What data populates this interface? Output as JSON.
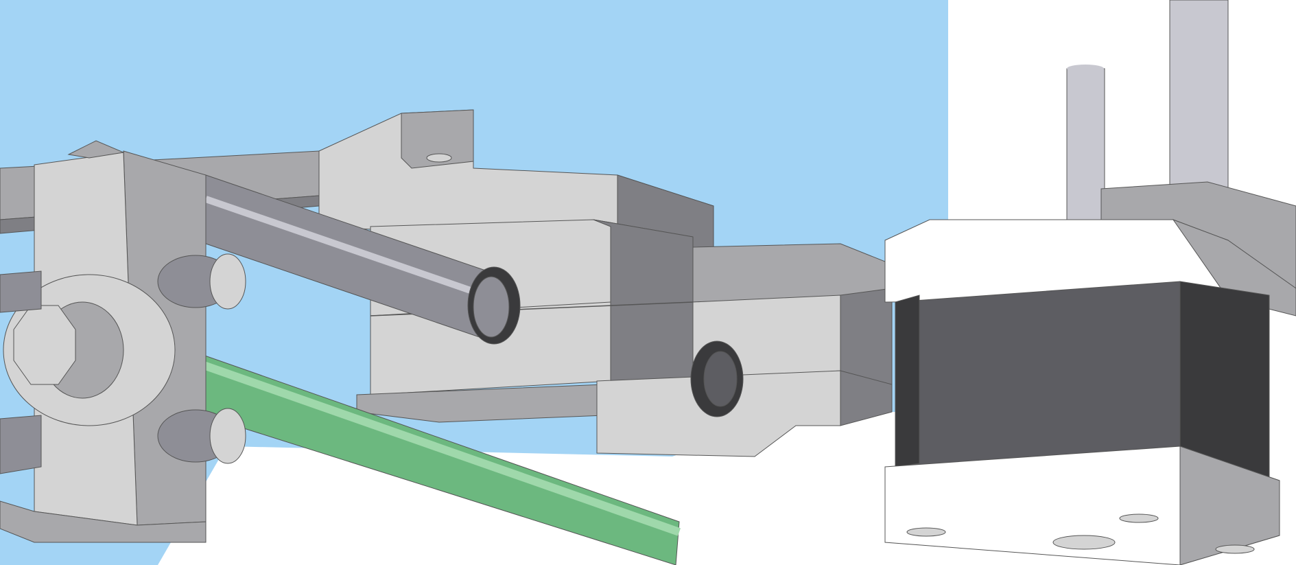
{
  "scene": {
    "background": "#a3d4f5",
    "floor_color": "#ffffff",
    "colors": {
      "light": "#d4d4d4",
      "mid": "#a8a8ab",
      "dark": "#7f7f84",
      "darker": "#5d5d62",
      "black_face": "#3a3a3c",
      "motor_top": "#ffffff",
      "rod_gray": "#8e8e96",
      "rod_highlight": "#c8c8d0",
      "rod_green": "#6cb87f",
      "rod_green_light": "#9fd8ab",
      "edge": "#555555"
    },
    "parts": [
      "x-end-idler-bracket",
      "smooth-rod-upper",
      "smooth-rod-lower-selected",
      "linear-bearing-holder",
      "carriage-plate",
      "stepper-motor",
      "motor-shaft",
      "threaded-rod"
    ]
  }
}
